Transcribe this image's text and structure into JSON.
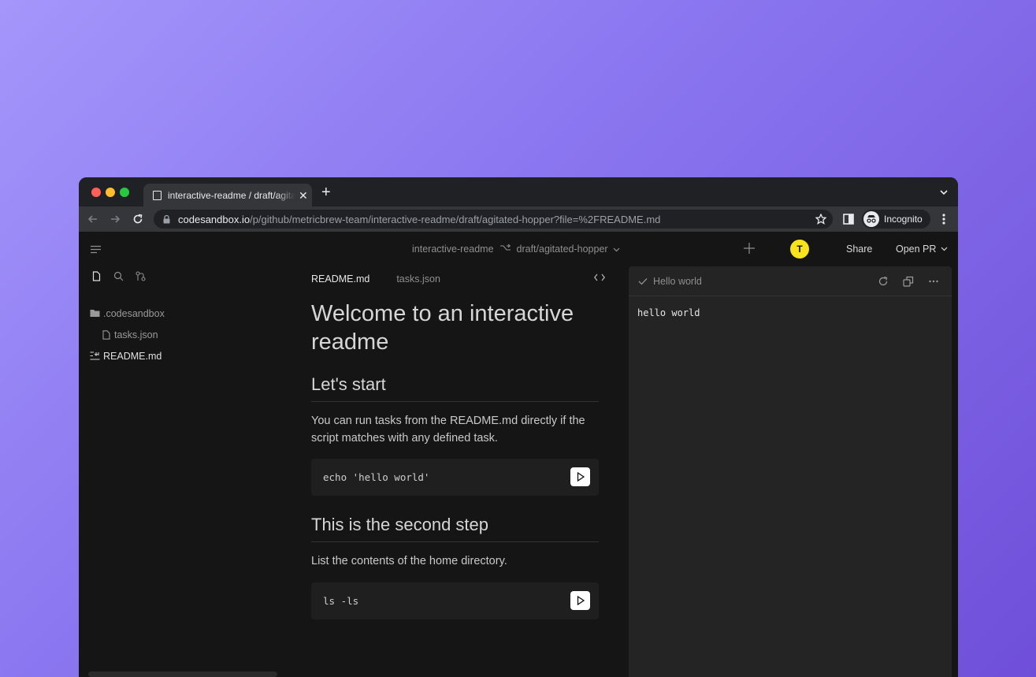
{
  "browser": {
    "tab_title": "interactive-readme / draft/agitated-hopper",
    "url_host": "codesandbox.io",
    "url_path": "/p/github/metricbrew-team/interactive-readme/draft/agitated-hopper?file=%2FREADME.md",
    "profile_label": "Incognito"
  },
  "header": {
    "repo": "interactive-readme",
    "branch": "draft/agitated-hopper",
    "avatar_initial": "T",
    "avatar_color": "#f8e31d",
    "share_label": "Share",
    "open_pr_label": "Open PR"
  },
  "sidebar": {
    "tools": [
      "file-icon",
      "search-icon",
      "git-icon"
    ],
    "items": [
      {
        "label": ".codesandbox",
        "icon": "folder-icon"
      },
      {
        "label": "tasks.json",
        "icon": "file-icon"
      },
      {
        "label": "README.md",
        "icon": "markdown-icon"
      }
    ]
  },
  "editor": {
    "tabs": [
      "README.md",
      "tasks.json"
    ],
    "h1": "Welcome to an interactive readme",
    "sections": [
      {
        "heading": "Let's start",
        "text": "You can run tasks from the README.md directly if the script matches with any defined task.",
        "code": "echo 'hello world'"
      },
      {
        "heading": "This is the second step",
        "text": "List the contents of the home directory.",
        "code": "ls -ls"
      }
    ]
  },
  "terminal": {
    "title": "Hello world",
    "output": "hello world"
  }
}
